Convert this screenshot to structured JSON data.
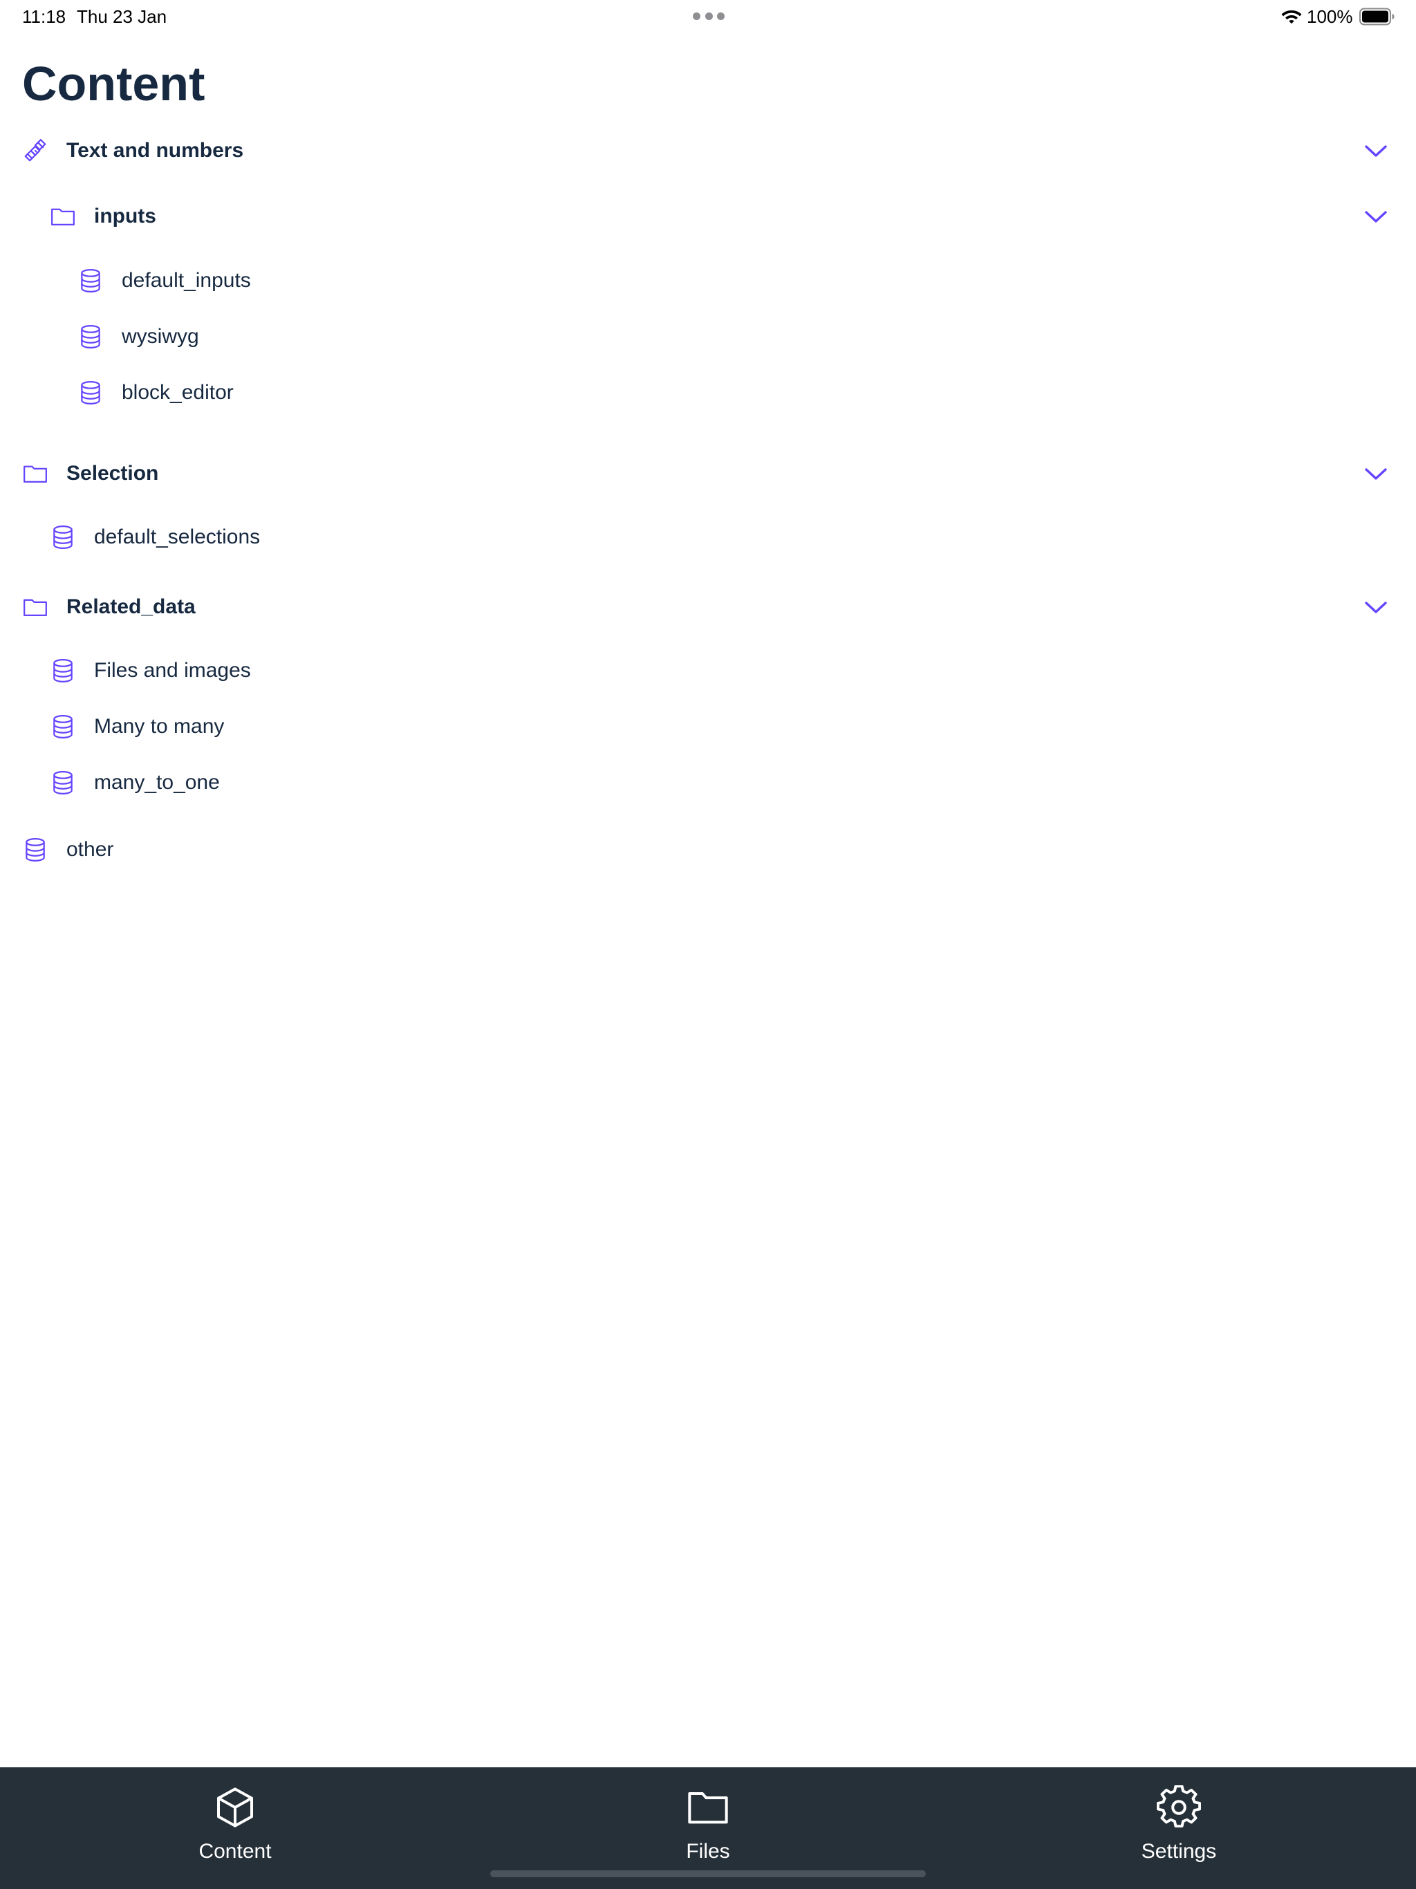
{
  "status_bar": {
    "time": "11:18",
    "date": "Thu 23 Jan",
    "battery": "100%"
  },
  "page": {
    "title": "Content"
  },
  "tree": {
    "text_and_numbers": {
      "label": "Text and numbers",
      "icon": "handshake-icon"
    },
    "inputs": {
      "label": "inputs",
      "icon": "folder-icon"
    },
    "default_inputs": {
      "label": "default_inputs",
      "icon": "database-icon"
    },
    "wysiwyg": {
      "label": "wysiwyg",
      "icon": "database-icon"
    },
    "block_editor": {
      "label": "block_editor",
      "icon": "database-icon"
    },
    "selection": {
      "label": "Selection",
      "icon": "folder-icon"
    },
    "default_selections": {
      "label": "default_selections",
      "icon": "database-icon"
    },
    "related_data": {
      "label": "Related_data",
      "icon": "folder-icon"
    },
    "files_and_images": {
      "label": "Files and images",
      "icon": "database-icon"
    },
    "many_to_many": {
      "label": "Many to many",
      "icon": "database-icon"
    },
    "many_to_one": {
      "label": "many_to_one",
      "icon": "database-icon"
    },
    "other": {
      "label": "other",
      "icon": "database-icon"
    }
  },
  "tab_bar": {
    "content": {
      "label": "Content",
      "icon": "cube-icon"
    },
    "files": {
      "label": "Files",
      "icon": "folder-icon"
    },
    "settings": {
      "label": "Settings",
      "icon": "gear-icon"
    }
  },
  "colors": {
    "accent": "#6644ff",
    "text": "#172940",
    "tab_bar_bg": "#263038"
  }
}
